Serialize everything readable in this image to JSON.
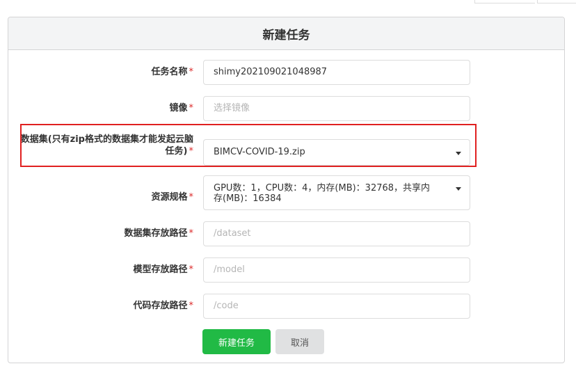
{
  "header": {
    "title": "新建任务"
  },
  "required_mark": "*",
  "form": {
    "task_name": {
      "label": "任务名称",
      "value": "shimy202109021048987"
    },
    "image": {
      "label": "镜像",
      "placeholder": "选择镜像"
    },
    "dataset": {
      "label_line1": "数据集(只有zip格式的数据集才能发起云脑",
      "label_line2": "任务)",
      "value": "BIMCV-COVID-19.zip"
    },
    "resource_spec": {
      "label": "资源规格",
      "value_line1": "GPU数：1，CPU数：4，内存(MB)：32768，共享内",
      "value_line2": "存(MB)：16384"
    },
    "dataset_path": {
      "label": "数据集存放路径",
      "placeholder": "/dataset"
    },
    "model_path": {
      "label": "模型存放路径",
      "placeholder": "/model"
    },
    "code_path": {
      "label": "代码存放路径",
      "placeholder": "/code"
    }
  },
  "buttons": {
    "create": "新建任务",
    "cancel": "取消"
  },
  "colors": {
    "primary": "#21ba45",
    "required": "#db2828",
    "highlight": "#e02020"
  }
}
